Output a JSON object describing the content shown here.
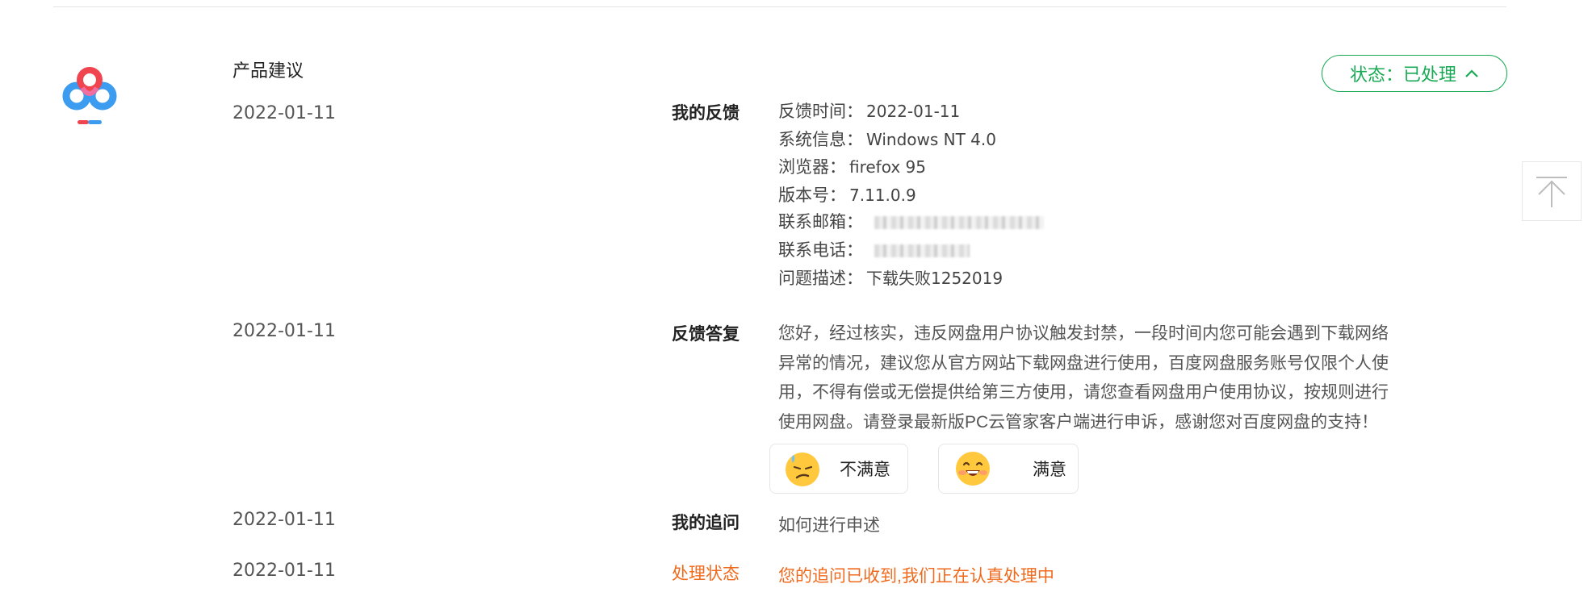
{
  "feedback": {
    "category": "产品建议",
    "status_button": "状态：已处理",
    "sections": {
      "my_feedback": {
        "date": "2022-01-11",
        "label": "我的反馈",
        "fields": [
          {
            "key": "反馈时间：",
            "value": "2022-01-11"
          },
          {
            "key": "系统信息：",
            "value": "Windows NT 4.0"
          },
          {
            "key": "浏览器：",
            "value": "firefox 95"
          },
          {
            "key": "版本号：",
            "value": "7.11.0.9"
          },
          {
            "key": "联系邮箱：",
            "value": ""
          },
          {
            "key": "联系电话：",
            "value": ""
          },
          {
            "key": "问题描述：",
            "value": "下载失败1252019"
          }
        ]
      },
      "reply": {
        "date": "2022-01-11",
        "label": "反馈答复",
        "lines": [
          "您好，经过核实，违反网盘用户协议触发封禁，一段时间内您可能会遇到下载网络",
          "异常的情况，建议您从官方网站下载网盘进行使用，百度网盘服务账号仅限个人使",
          "用，不得有偿或无偿提供给第三方使用，请您查看网盘用户使用协议，按规则进行",
          "使用网盘。请登录最新版PC云管家客户端进行申诉，感谢您对百度网盘的支持！"
        ],
        "unsatisfied": "不满意",
        "satisfied": "满意"
      },
      "followup": {
        "date": "2022-01-11",
        "label": "我的追问",
        "text": "如何进行申述"
      },
      "processing": {
        "date": "2022-01-11",
        "label": "处理状态",
        "text": "您的追问已收到,我们正在认真处理中"
      }
    }
  },
  "colors": {
    "accent_green": "#1aaa55",
    "accent_orange": "#f06a1d",
    "logo_blue": "#3b9cf0",
    "logo_red": "#f0444f"
  },
  "icons": [
    "baidu-netdisk-logo-icon",
    "chevron-up-icon",
    "back-to-top-icon",
    "sweat-face-icon",
    "grin-face-icon"
  ]
}
